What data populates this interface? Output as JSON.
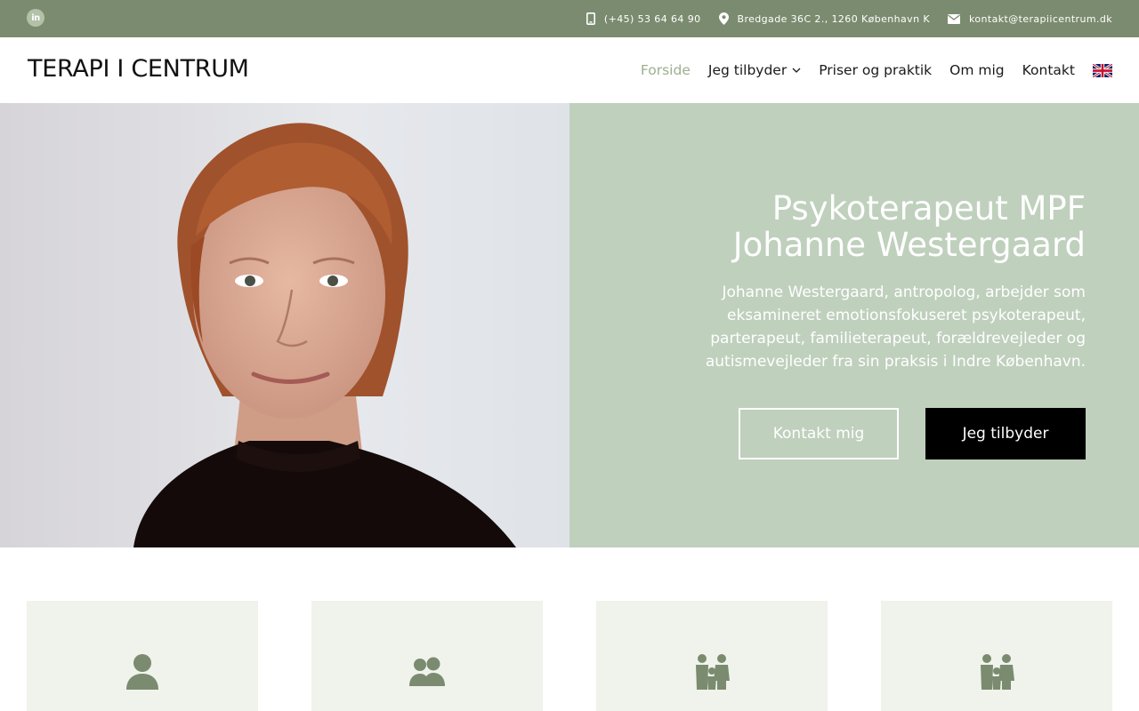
{
  "topbar": {
    "social_icon": "linkedin-icon",
    "social_text": "in",
    "phone": "(+45) 53 64 64 90",
    "address": "Bredgade 36C 2., 1260 København K",
    "email": "kontakt@terapiicentrum.dk",
    "icons": [
      "phone-icon",
      "map-pin-icon",
      "envelope-icon"
    ]
  },
  "header": {
    "logo": "TERAPI I CENTRUM",
    "nav": [
      {
        "label": "Forside",
        "active": true
      },
      {
        "label": "Jeg tilbyder",
        "has_dropdown": true
      },
      {
        "label": "Priser og praktik"
      },
      {
        "label": "Om mig"
      },
      {
        "label": "Kontakt"
      }
    ],
    "language_icon": "uk-flag-icon"
  },
  "hero": {
    "image": "portrait-photo",
    "title_line1": "Psykoterapeut MPF",
    "title_line2": "Johanne Westergaard",
    "text": "Johanne Westergaard, antropolog, arbejder som eksamineret emotionsfokuseret psykoterapeut, parterapeut, familieterapeut, forældrevejleder og autismevejleder fra sin praksis i Indre København.",
    "button_primary": "Kontakt mig",
    "button_secondary": "Jeg tilbyder"
  },
  "cards": [
    {
      "icon": "single-person-icon"
    },
    {
      "icon": "two-persons-icon"
    },
    {
      "icon": "family-icon"
    },
    {
      "icon": "family-icon"
    }
  ],
  "colors": {
    "topbar": "#7b8b6f",
    "accent": "#9bb08e",
    "hero_panel": "#bfd0bd",
    "card_bg": "#f0f3ec",
    "icon": "#7b8b6f"
  }
}
